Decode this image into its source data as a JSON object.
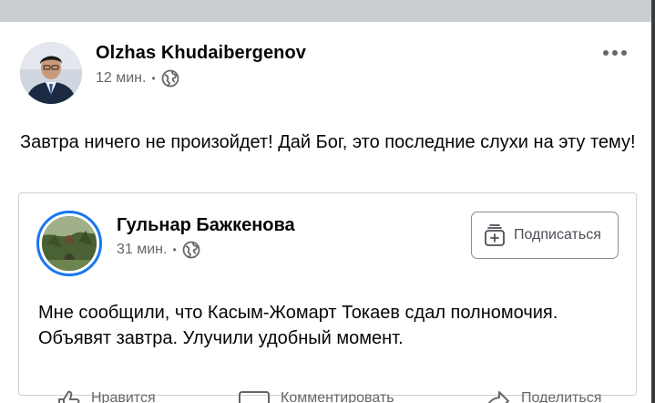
{
  "post": {
    "author": "Olzhas Khudaibergenov",
    "time": "12 мин.",
    "separator": "•",
    "privacy_icon": "globe-icon",
    "more_icon": "more-horizontal-icon",
    "text": "Завтра ничего не произойдет! Дай Бог, это последние слухи на эту тему!"
  },
  "shared": {
    "author": "Гульнар Бажкенова",
    "time": "31 мин.",
    "separator": "•",
    "privacy_icon": "globe-icon",
    "subscribe_label": "Подписаться",
    "subscribe_icon": "follow-add-icon",
    "text": "Мне сообщили, что Касым-Жомарт Токаев сдал полномочия. Объявят завтра. Улучили удобный момент."
  },
  "actions": {
    "like_label": "Нравится",
    "comment_label": "Комментировать",
    "share_label": "Поделиться"
  },
  "colors": {
    "accent": "#1877f2",
    "secondary_text": "#65676b",
    "border": "#ced0d4"
  }
}
